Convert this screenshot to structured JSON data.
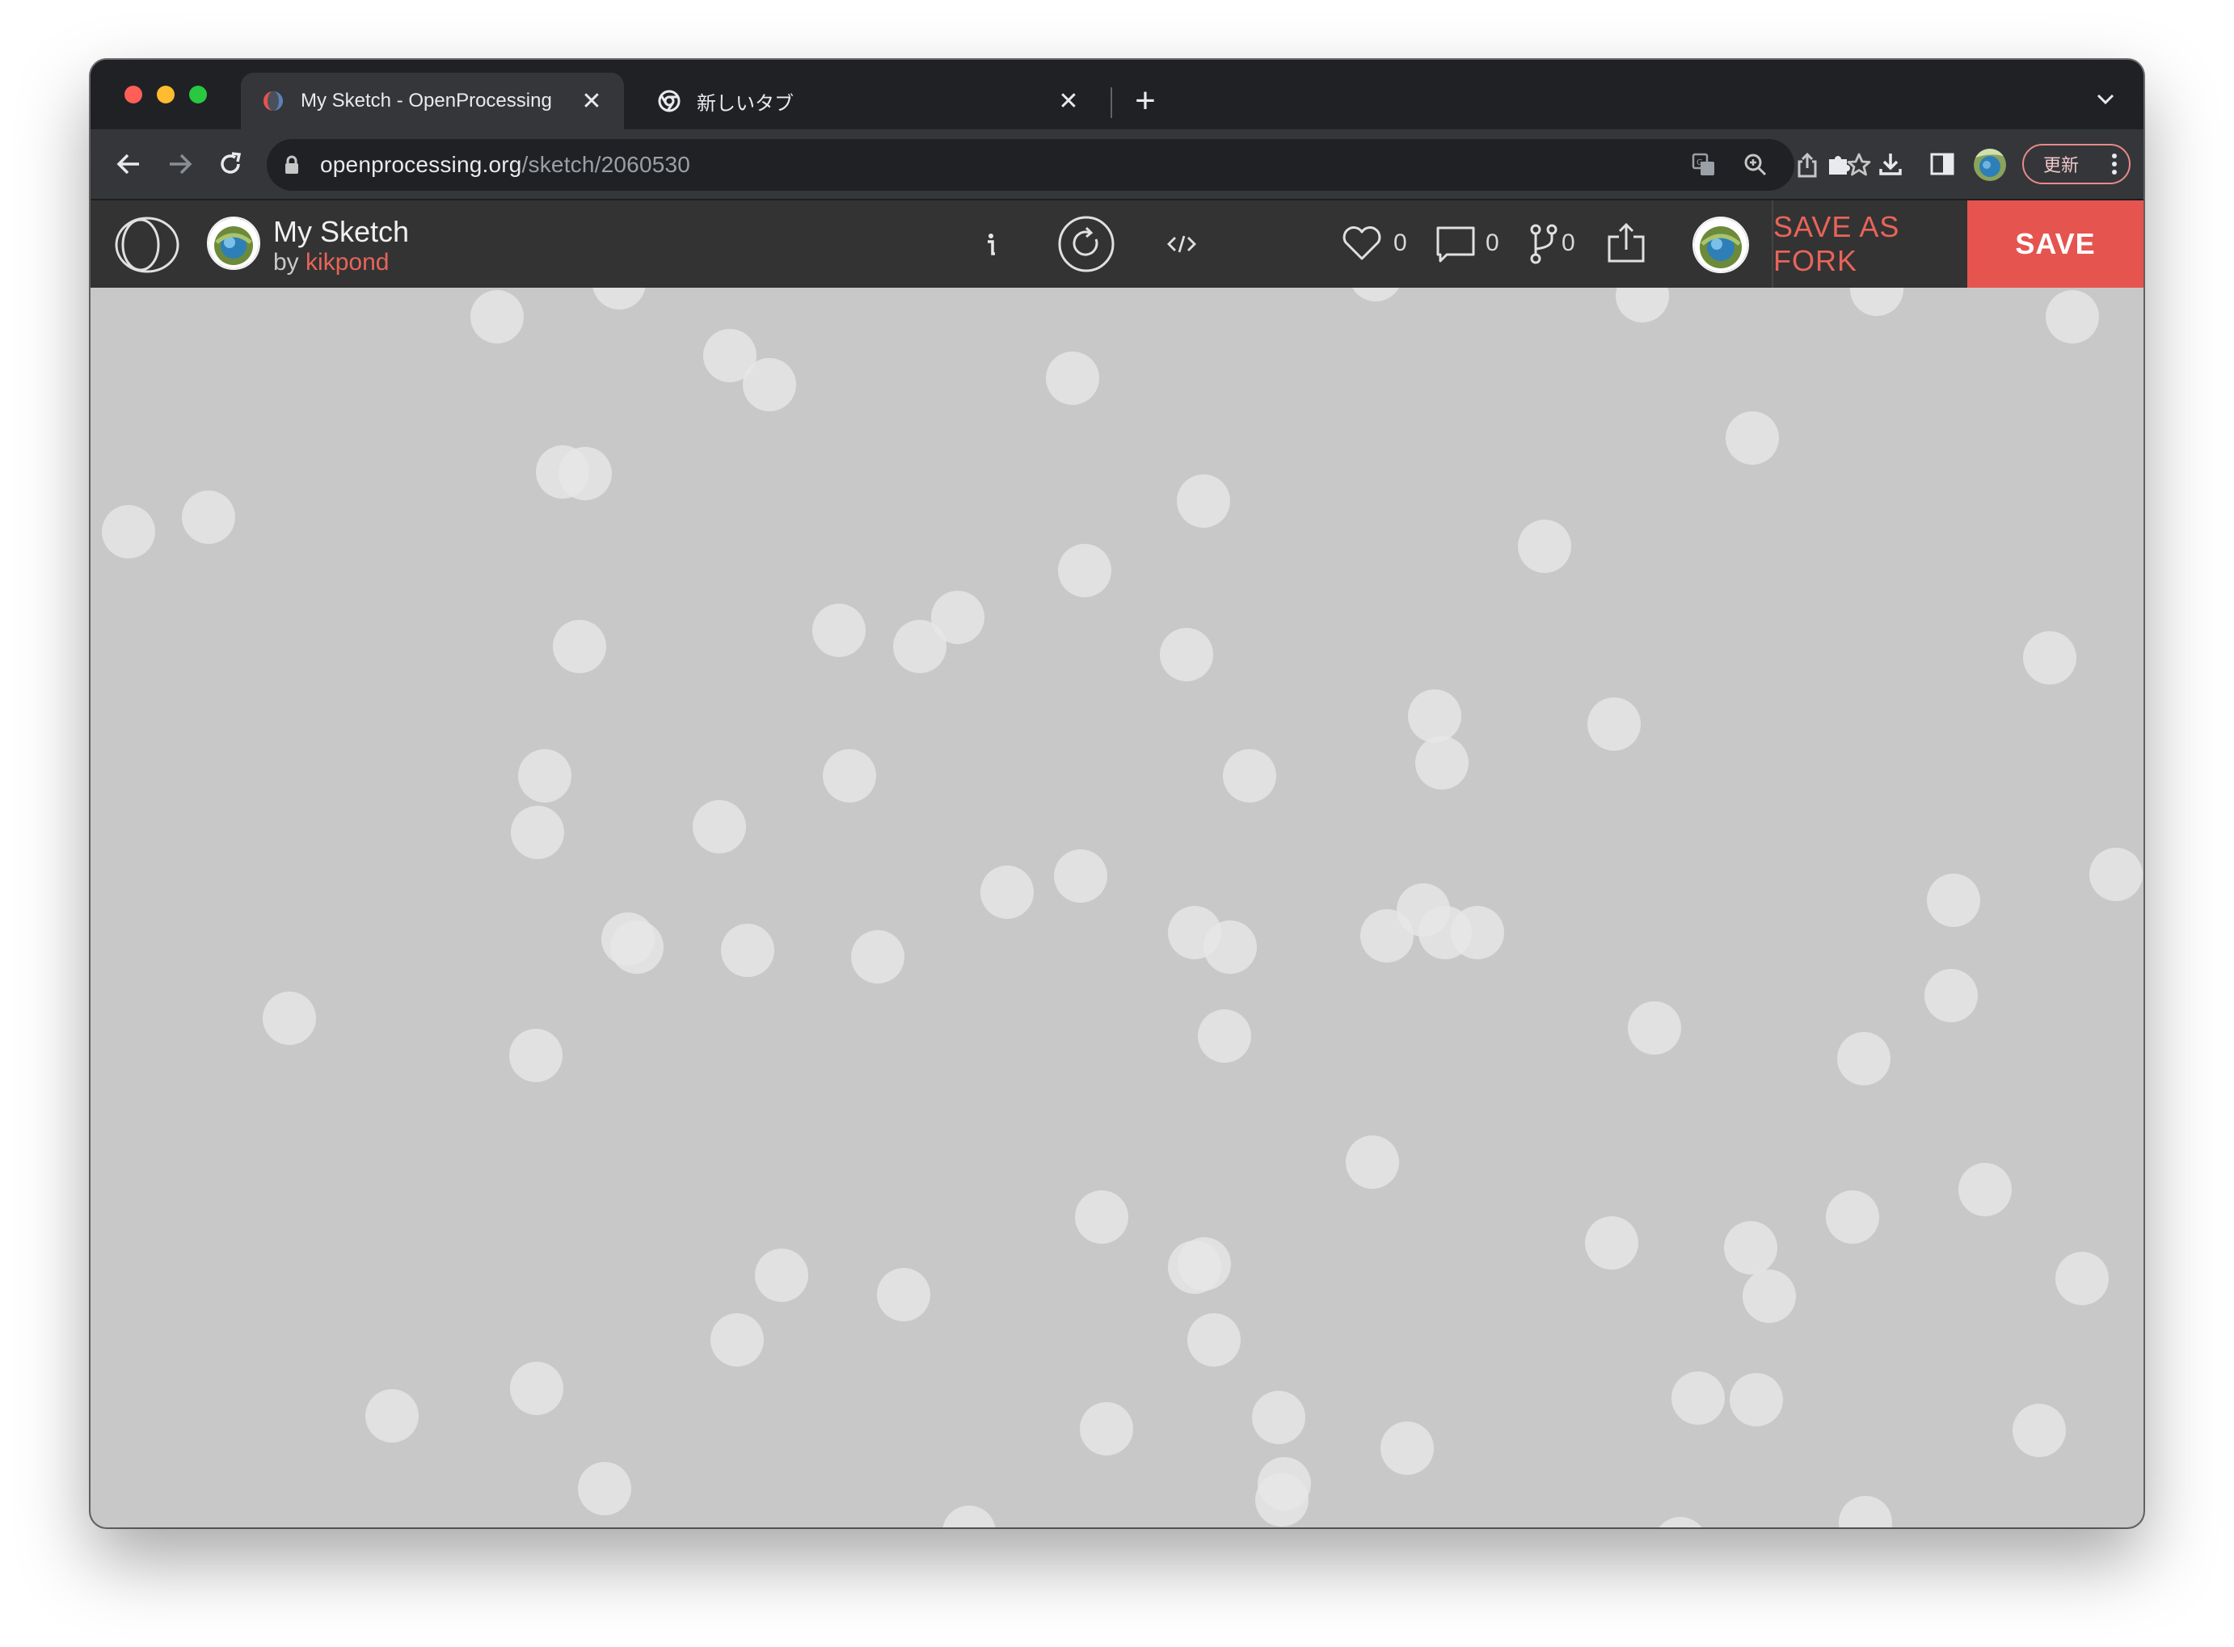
{
  "browser": {
    "tabs": [
      {
        "title": "My Sketch - OpenProcessing",
        "active": true,
        "favicon": "openprocessing-favicon"
      },
      {
        "title": "新しいタブ",
        "active": false,
        "favicon": "chrome-favicon"
      }
    ],
    "address": {
      "host": "openprocessing.org",
      "path": "/sketch/2060530"
    },
    "update_label": "更新",
    "colors": {
      "frame": "#202124",
      "toolbar": "#35363a"
    }
  },
  "openprocessing": {
    "sketch_title": "My Sketch",
    "by_label": "by",
    "author": "kikpond",
    "likes": "0",
    "comments": "0",
    "forks": "0",
    "fork_label": "SAVE AS FORK",
    "save_label": "SAVE",
    "colors": {
      "header": "#333333",
      "accent": "#e5544e",
      "canvas": "#c8c8c8",
      "circle": "#e6e6e6"
    }
  }
}
